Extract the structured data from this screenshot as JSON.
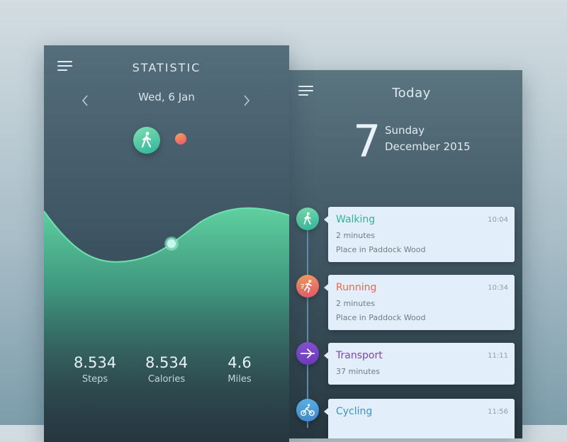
{
  "statistic": {
    "title": "STATISTIC",
    "date": "Wed, 6 Jan",
    "stats": [
      {
        "value": "8.534",
        "label": "Steps"
      },
      {
        "value": "8.534",
        "label": "Calories"
      },
      {
        "value": "4.6",
        "label": "Miles"
      }
    ],
    "icons": {
      "menu": "menu-icon",
      "prev": "chevron-left-icon",
      "next": "chevron-right-icon",
      "activity": "walking-icon"
    }
  },
  "today": {
    "title": "Today",
    "day_number": "7",
    "weekday": "Sunday",
    "month_year": "December 2015",
    "timeline": [
      {
        "title": "Walking",
        "time": "10:04",
        "duration": "2 minutes",
        "place": "Place in Paddock Wood",
        "color": "#2fb39a",
        "icon": "walking-icon"
      },
      {
        "title": "Running",
        "time": "10:34",
        "duration": "2 minutes",
        "place": "Place in Paddock Wood",
        "color": "#e9684f",
        "icon": "running-icon"
      },
      {
        "title": "Transport",
        "time": "11:11",
        "duration": "37 minutes",
        "place": "",
        "color": "#7a44c8",
        "icon": "transport-icon"
      },
      {
        "title": "Cycling",
        "time": "11:56",
        "duration": "",
        "place": "",
        "color": "#3f93d6",
        "icon": "cycling-icon"
      }
    ]
  },
  "colors": {
    "accent_green": "#5fd0a0",
    "walk": "#2fb39a",
    "run": "#e9684f",
    "transport": "#7a44c8",
    "cycle": "#3f93d6"
  }
}
